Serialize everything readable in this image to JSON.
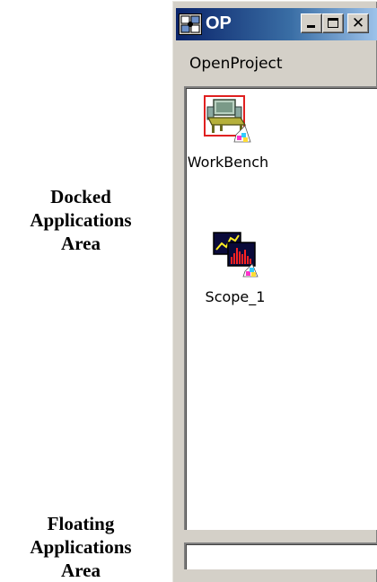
{
  "annotations": {
    "docked": [
      "Docked",
      "Applications",
      "Area"
    ],
    "floating": [
      "Floating",
      "Applications",
      "Area"
    ]
  },
  "window": {
    "title": "OP",
    "title_icon": "openproject-app-icon",
    "controls": {
      "minimize": "minimize-icon",
      "maximize": "maximize-icon",
      "close": "close-icon",
      "close_glyph": "✕"
    },
    "menu": {
      "items": [
        {
          "label": "OpenProject"
        }
      ]
    },
    "docked_apps": [
      {
        "label": "WorkBench",
        "icon": "workbench-icon",
        "selected": true
      },
      {
        "label": "Scope_1",
        "icon": "scope-icon",
        "selected": false
      }
    ],
    "colors": {
      "titlebar_start": "#0a246a",
      "titlebar_end": "#a6caf0",
      "window_face": "#d4d0c8",
      "selection_border": "#e02020"
    }
  }
}
